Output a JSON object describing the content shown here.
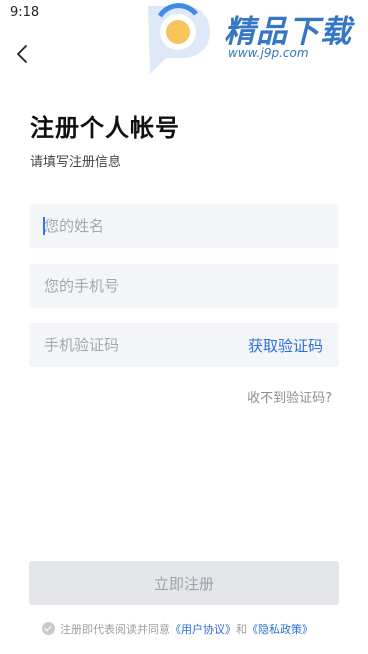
{
  "status_bar": {
    "time": "9:18"
  },
  "watermark": {
    "title": "精品下载",
    "url": "www.j9p.com",
    "logo_icon": "p-logo-icon",
    "color": "#3577c4"
  },
  "header": {
    "back_icon": "chevron-left-icon"
  },
  "page": {
    "title": "注册个人帐号",
    "subtitle": "请填写注册信息"
  },
  "form": {
    "name_placeholder": "您的姓名",
    "name_value": "",
    "phone_placeholder": "您的手机号",
    "phone_value": "",
    "code_placeholder": "手机验证码",
    "code_value": "",
    "get_code_label": "获取验证码",
    "no_code_label": "收不到验证码?",
    "submit_label": "立即注册"
  },
  "agreement": {
    "prefix": "注册即代表阅读并同意",
    "user_agreement": "《用户协议》",
    "and": "和",
    "privacy_policy": "《隐私政策》"
  },
  "colors": {
    "accent": "#2d6fd8",
    "field_bg": "#f3f5f8",
    "button_disabled_bg": "#e4e6ea"
  }
}
